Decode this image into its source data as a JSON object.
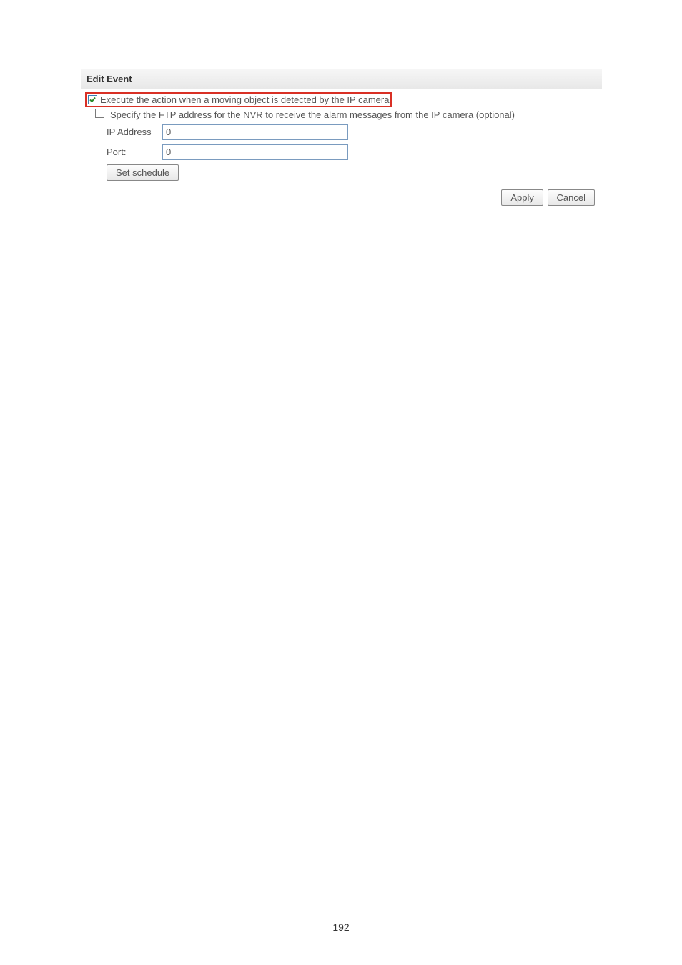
{
  "dialog": {
    "title": "Edit Event",
    "option1_label": "Execute the action when a moving object is detected by the IP camera",
    "option2_label": "Specify the FTP address for the NVR to receive the alarm messages from the IP camera (optional)",
    "ip_label": "IP Address",
    "ip_value": "0",
    "port_label": "Port:",
    "port_value": "0",
    "set_schedule_label": "Set schedule",
    "apply_label": "Apply",
    "cancel_label": "Cancel"
  },
  "page_number": "192"
}
